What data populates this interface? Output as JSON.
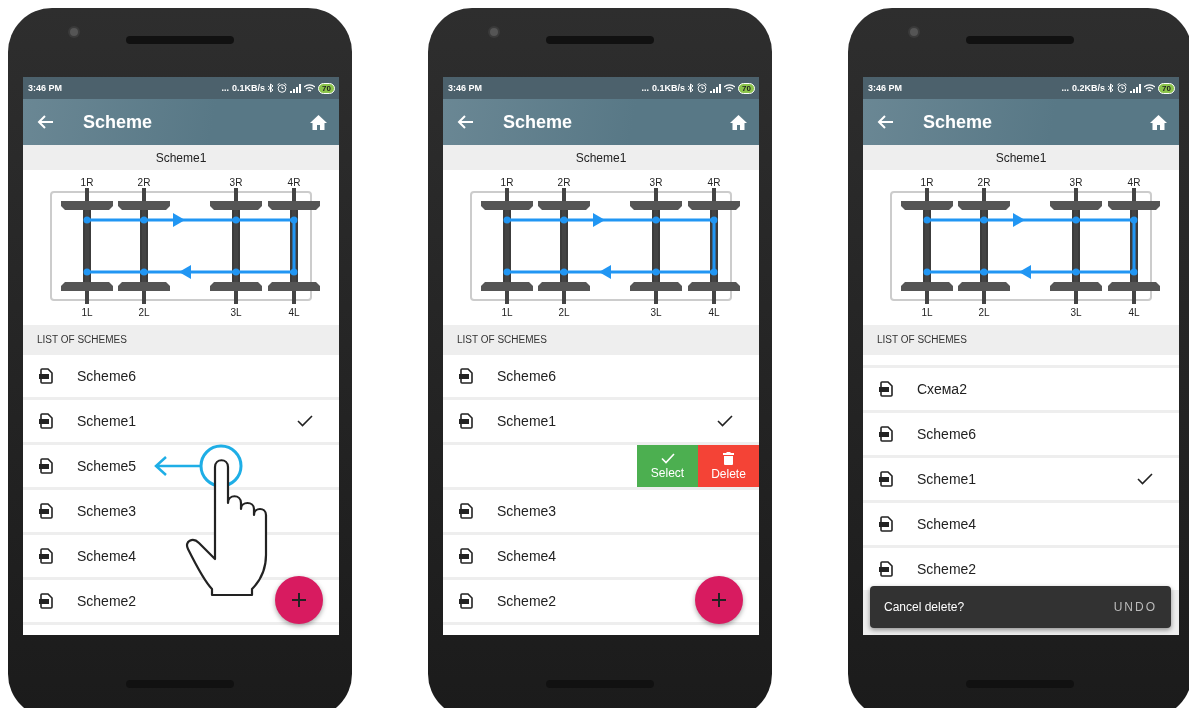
{
  "phones": [
    {
      "status_bar": {
        "time": "3:46 PM",
        "dots": "...",
        "speed": "0.1KB/s",
        "battery": "70"
      },
      "app_bar": {
        "title": "Scheme"
      },
      "current_scheme": "Scheme1",
      "diagram": {
        "top_labels": [
          "1R",
          "2R",
          "3R",
          "4R"
        ],
        "bottom_labels": [
          "1L",
          "2L",
          "3L",
          "4L"
        ]
      },
      "list_header": "LIST OF SCHEMES",
      "rows": [
        {
          "kind": "item",
          "name": "Scheme6",
          "selected": false
        },
        {
          "kind": "item",
          "name": "Scheme1",
          "selected": true
        },
        {
          "kind": "item",
          "name": "Scheme5",
          "selected": false
        },
        {
          "kind": "item",
          "name": "Scheme3",
          "selected": false
        },
        {
          "kind": "item",
          "name": "Scheme4",
          "selected": false
        },
        {
          "kind": "item",
          "name": "Scheme2",
          "selected": false
        },
        {
          "kind": "partial"
        }
      ],
      "swipe_hint": true,
      "fab": true
    },
    {
      "status_bar": {
        "time": "3:46 PM",
        "dots": "...",
        "speed": "0.1KB/s",
        "battery": "70"
      },
      "app_bar": {
        "title": "Scheme"
      },
      "current_scheme": "Scheme1",
      "diagram": {
        "top_labels": [
          "1R",
          "2R",
          "3R",
          "4R"
        ],
        "bottom_labels": [
          "1L",
          "2L",
          "3L",
          "4L"
        ]
      },
      "list_header": "LIST OF SCHEMES",
      "rows": [
        {
          "kind": "item",
          "name": "Scheme6",
          "selected": false
        },
        {
          "kind": "item",
          "name": "Scheme1",
          "selected": true
        },
        {
          "kind": "swiped",
          "actions": [
            "Select",
            "Delete"
          ]
        },
        {
          "kind": "item",
          "name": "Scheme3",
          "selected": false
        },
        {
          "kind": "item",
          "name": "Scheme4",
          "selected": false
        },
        {
          "kind": "item",
          "name": "Scheme2",
          "selected": false
        },
        {
          "kind": "partial"
        }
      ],
      "fab": true
    },
    {
      "status_bar": {
        "time": "3:46 PM",
        "dots": "...",
        "speed": "0.2KB/s",
        "battery": "70"
      },
      "app_bar": {
        "title": "Scheme"
      },
      "current_scheme": "Scheme1",
      "diagram": {
        "top_labels": [
          "1R",
          "2R",
          "3R",
          "4R"
        ],
        "bottom_labels": [
          "1L",
          "2L",
          "3L",
          "4L"
        ]
      },
      "list_header": "LIST OF SCHEMES",
      "rows": [
        {
          "kind": "partial-top"
        },
        {
          "kind": "item",
          "name": "Схема2",
          "selected": false
        },
        {
          "kind": "item",
          "name": "Scheme6",
          "selected": false
        },
        {
          "kind": "item",
          "name": "Scheme1",
          "selected": true
        },
        {
          "kind": "item",
          "name": "Scheme4",
          "selected": false
        },
        {
          "kind": "item",
          "name": "Scheme2",
          "selected": false
        }
      ],
      "fab": false,
      "snackbar": {
        "message": "Cancel delete?",
        "action": "UNDO"
      }
    }
  ]
}
